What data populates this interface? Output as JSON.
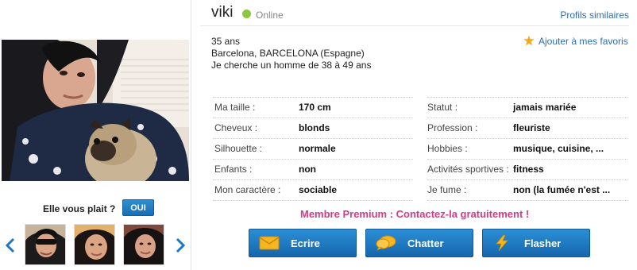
{
  "profile": {
    "name": "viki",
    "status": "Online",
    "age": "35 ans",
    "location": "Barcelona, BARCELONA (Espagne)",
    "looking_for": "Je cherche un homme de 38 à 49 ans"
  },
  "links": {
    "similar": "Profils similaires",
    "favorite": "Ajouter à mes favoris"
  },
  "like": {
    "question": "Elle vous plait ?",
    "yes_label": "OUI"
  },
  "details_left": [
    {
      "label": "Ma taille :",
      "value": "170 cm"
    },
    {
      "label": "Cheveux :",
      "value": "blonds"
    },
    {
      "label": "Silhouette :",
      "value": "normale"
    },
    {
      "label": "Enfants :",
      "value": "non"
    },
    {
      "label": "Mon caractère :",
      "value": "sociable"
    }
  ],
  "details_right": [
    {
      "label": "Statut :",
      "value": "jamais mariée"
    },
    {
      "label": "Profession :",
      "value": "fleuriste"
    },
    {
      "label": "Hobbies :",
      "value": "musique, cuisine, ..."
    },
    {
      "label": "Activités sportives :",
      "value": "fitness"
    },
    {
      "label": "Je fume :",
      "value": "non (la fumée n'est ..."
    }
  ],
  "premium_text": "Membre Premium : Contactez-la gratuitement !",
  "actions": {
    "write": "Ecrire",
    "chat": "Chatter",
    "flash": "Flasher"
  },
  "colors": {
    "accent_blue": "#1b78c2",
    "online_green": "#8dc63f",
    "premium_pink": "#d43b86",
    "star_orange": "#f4a81d"
  },
  "icons": [
    "chevron-left-icon",
    "chevron-right-icon",
    "star-icon",
    "envelope-icon",
    "chat-bubble-icon",
    "lightning-icon"
  ]
}
